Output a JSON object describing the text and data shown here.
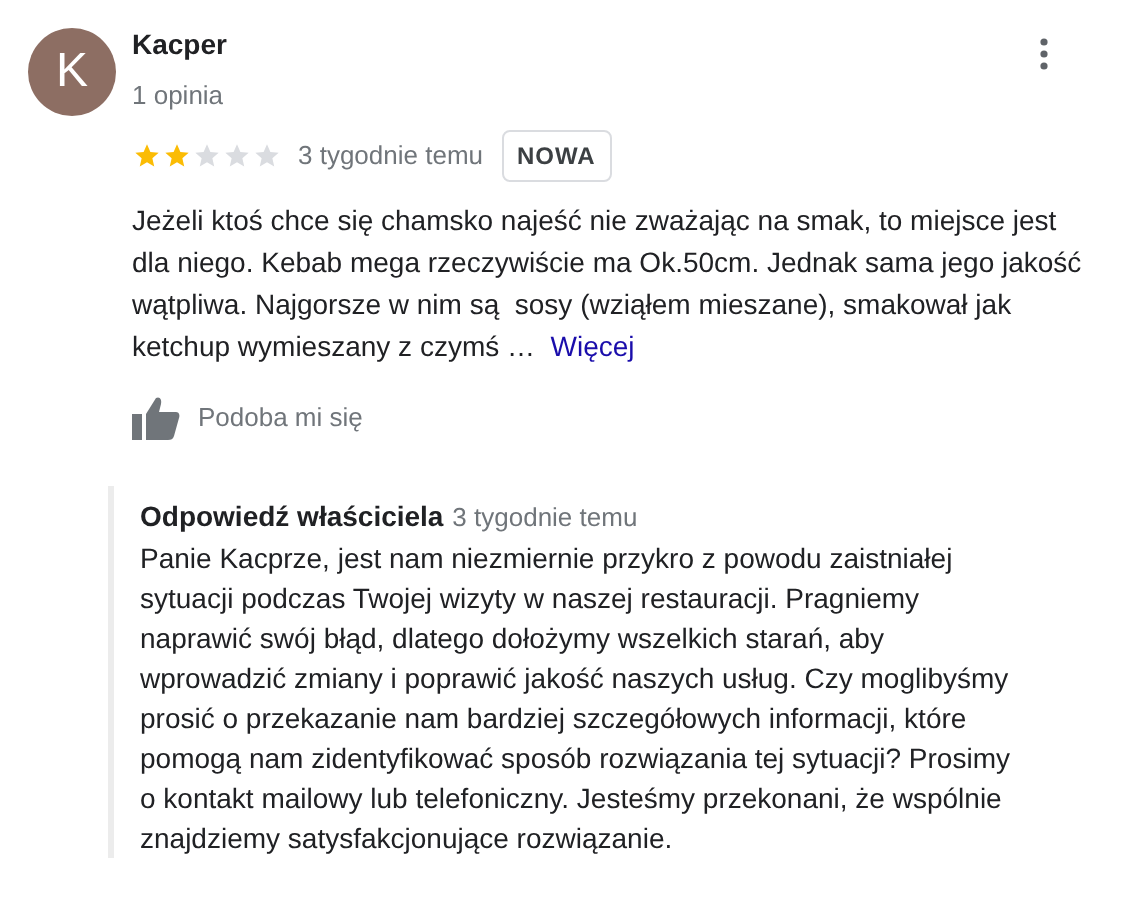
{
  "review": {
    "avatar_letter": "K",
    "author": "Kacper",
    "author_meta": "1 opinia",
    "stars": 2,
    "time": "3 tygodnie temu",
    "badge": "NOWA",
    "text": "Jeżeli ktoś chce się chamsko najeść nie zważając na smak, to miejsce jest dla niego. Kebab mega rzeczywiście ma Ok.50cm. Jednak sama jego jakość wątpliwa. Najgorsze w nim są  sosy (wziąłem mieszane), smakował jak ketchup wymieszany z czymś …",
    "more_link": "Więcej",
    "like_label": "Podoba mi się"
  },
  "owner_reply": {
    "title": "Odpowiedź właściciela",
    "time": "3 tygodnie temu",
    "text": "Panie Kacprze, jest nam niezmiernie przykro z powodu zaistniałej sytuacji podczas Twojej wizyty w naszej restauracji. Pragniemy naprawić swój błąd, dlatego dołożymy wszelkich starań, aby wprowadzić zmiany i poprawić jakość naszych usług. Czy moglibyśmy prosić o przekazanie nam bardziej szczegółowych informacji, które pomogą nam zidentyfikować sposób rozwiązania tej sytuacji? Prosimy o kontakt mailowy lub telefoniczny. Jesteśmy przekonani, że wspólnie znajdziemy satysfakcjonujące rozwiązanie."
  }
}
